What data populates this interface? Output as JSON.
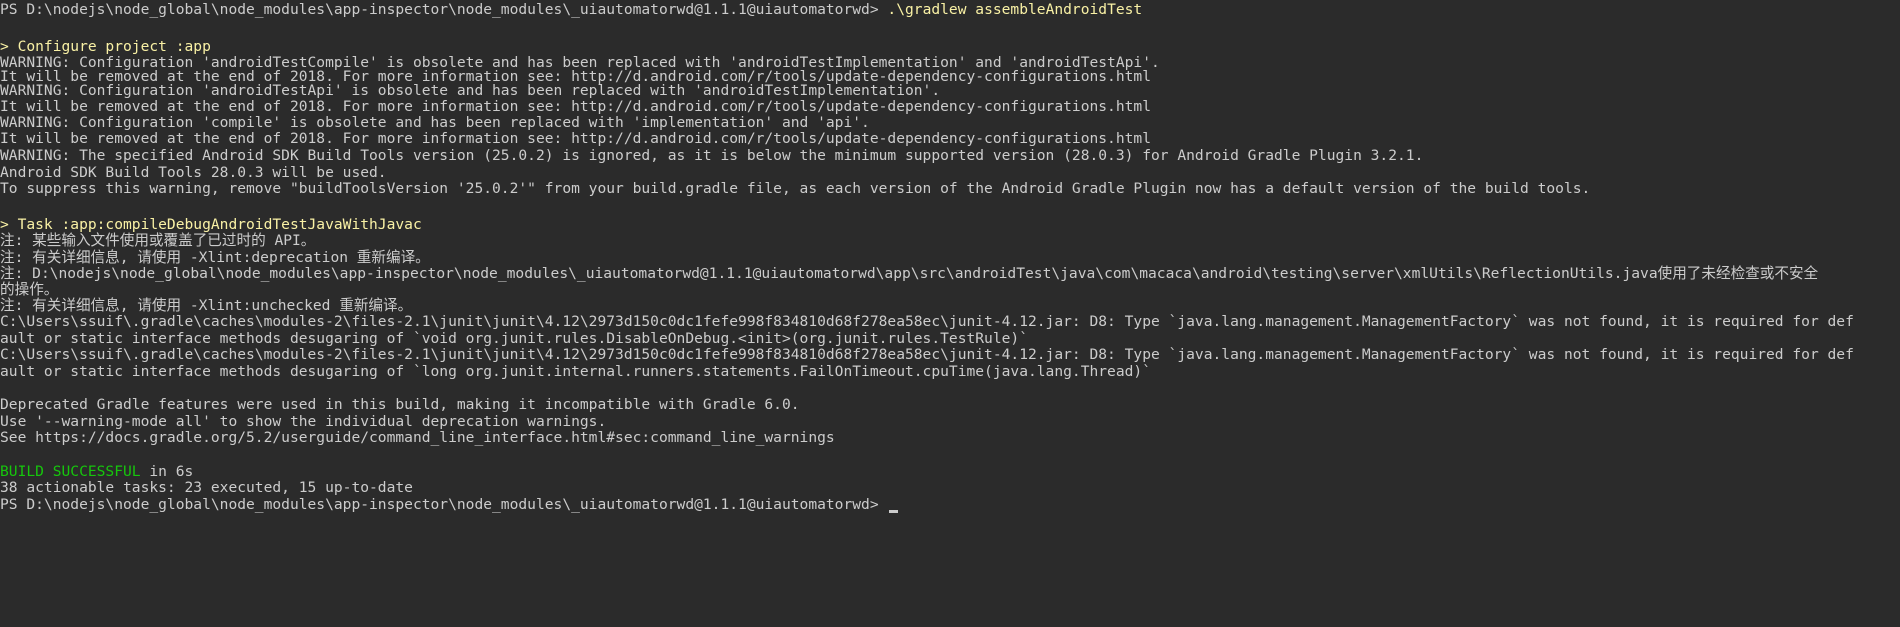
{
  "terminal": {
    "prompt_path": "PS D:\\nodejs\\node_global\\node_modules\\app-inspector\\node_modules\\_uiautomatorwd@1.1.1@uiautomatorwd>",
    "command": ".\\gradlew assembleAndroidTest",
    "configure_header": "> Configure project :app",
    "warnings": [
      "WARNING: Configuration 'androidTestCompile' is obsolete and has been replaced with 'androidTestImplementation' and 'androidTestApi'.",
      "It will be removed at the end of 2018. For more information see: http://d.android.com/r/tools/update-dependency-configurations.html",
      "WARNING: Configuration 'androidTestApi' is obsolete and has been replaced with 'androidTestImplementation'.",
      "It will be removed at the end of 2018. For more information see: http://d.android.com/r/tools/update-dependency-configurations.html",
      "WARNING: Configuration 'compile' is obsolete and has been replaced with 'implementation' and 'api'.",
      "It will be removed at the end of 2018. For more information see: http://d.android.com/r/tools/update-dependency-configurations.html",
      "WARNING: The specified Android SDK Build Tools version (25.0.2) is ignored, as it is below the minimum supported version (28.0.3) for Android Gradle Plugin 3.2.1.",
      "Android SDK Build Tools 28.0.3 will be used.",
      "To suppress this warning, remove \"buildToolsVersion '25.0.2'\" from your build.gradle file, as each version of the Android Gradle Plugin now has a default version of the build tools."
    ],
    "task_header": "> Task :app:compileDebugAndroidTestJavaWithJavac",
    "notes": [
      "注: 某些输入文件使用或覆盖了已过时的 API。",
      "注: 有关详细信息, 请使用 -Xlint:deprecation 重新编译。",
      "注: D:\\nodejs\\node_global\\node_modules\\app-inspector\\node_modules\\_uiautomatorwd@1.1.1@uiautomatorwd\\app\\src\\androidTest\\java\\com\\macaca\\android\\testing\\server\\xmlUtils\\ReflectionUtils.java使用了未经检查或不安全",
      "的操作。",
      "注: 有关详细信息, 请使用 -Xlint:unchecked 重新编译。",
      "C:\\Users\\ssuif\\.gradle\\caches\\modules-2\\files-2.1\\junit\\junit\\4.12\\2973d150c0dc1fefe998f834810d68f278ea58ec\\junit-4.12.jar: D8: Type `java.lang.management.ManagementFactory` was not found, it is required for def",
      "ault or static interface methods desugaring of `void org.junit.rules.DisableOnDebug.<init>(org.junit.rules.TestRule)`",
      "C:\\Users\\ssuif\\.gradle\\caches\\modules-2\\files-2.1\\junit\\junit\\4.12\\2973d150c0dc1fefe998f834810d68f278ea58ec\\junit-4.12.jar: D8: Type `java.lang.management.ManagementFactory` was not found, it is required for def",
      "ault or static interface methods desugaring of `long org.junit.internal.runners.statements.FailOnTimeout.cpuTime(java.lang.Thread)`"
    ],
    "deprecation": [
      "Deprecated Gradle features were used in this build, making it incompatible with Gradle 6.0.",
      "Use '--warning-mode all' to show the individual deprecation warnings.",
      "See https://docs.gradle.org/5.2/userguide/command_line_interface.html#sec:command_line_warnings"
    ],
    "build_status": "BUILD SUCCESSFUL",
    "build_time": " in 6s",
    "task_summary": "38 actionable tasks: 23 executed, 15 up-to-date"
  },
  "colors": {
    "background": "#2b2b2b",
    "text": "#cccccc",
    "highlight": "#f9f1a5",
    "success": "#16c60c"
  }
}
